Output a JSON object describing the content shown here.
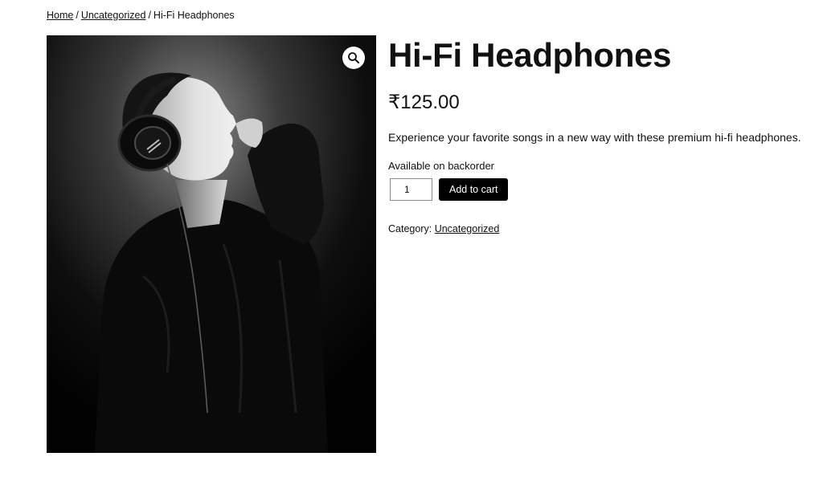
{
  "breadcrumb": {
    "home": "Home",
    "separator": "/",
    "category": "Uncategorized",
    "current": "Hi-Fi Headphones"
  },
  "product": {
    "title": "Hi-Fi Headphones",
    "price": "₹125.00",
    "description": "Experience your favorite songs in a new way with these premium hi-fi headphones.",
    "stock_status": "Available on backorder",
    "quantity": "1",
    "add_to_cart_label": "Add to cart",
    "category_label": "Category:",
    "category_link": "Uncategorized"
  },
  "image": {
    "zoom_icon": "magnifier-icon"
  },
  "colors": {
    "button_background": "#000000",
    "button_text": "#ffffff",
    "text": "#111111",
    "background": "#ffffff"
  }
}
